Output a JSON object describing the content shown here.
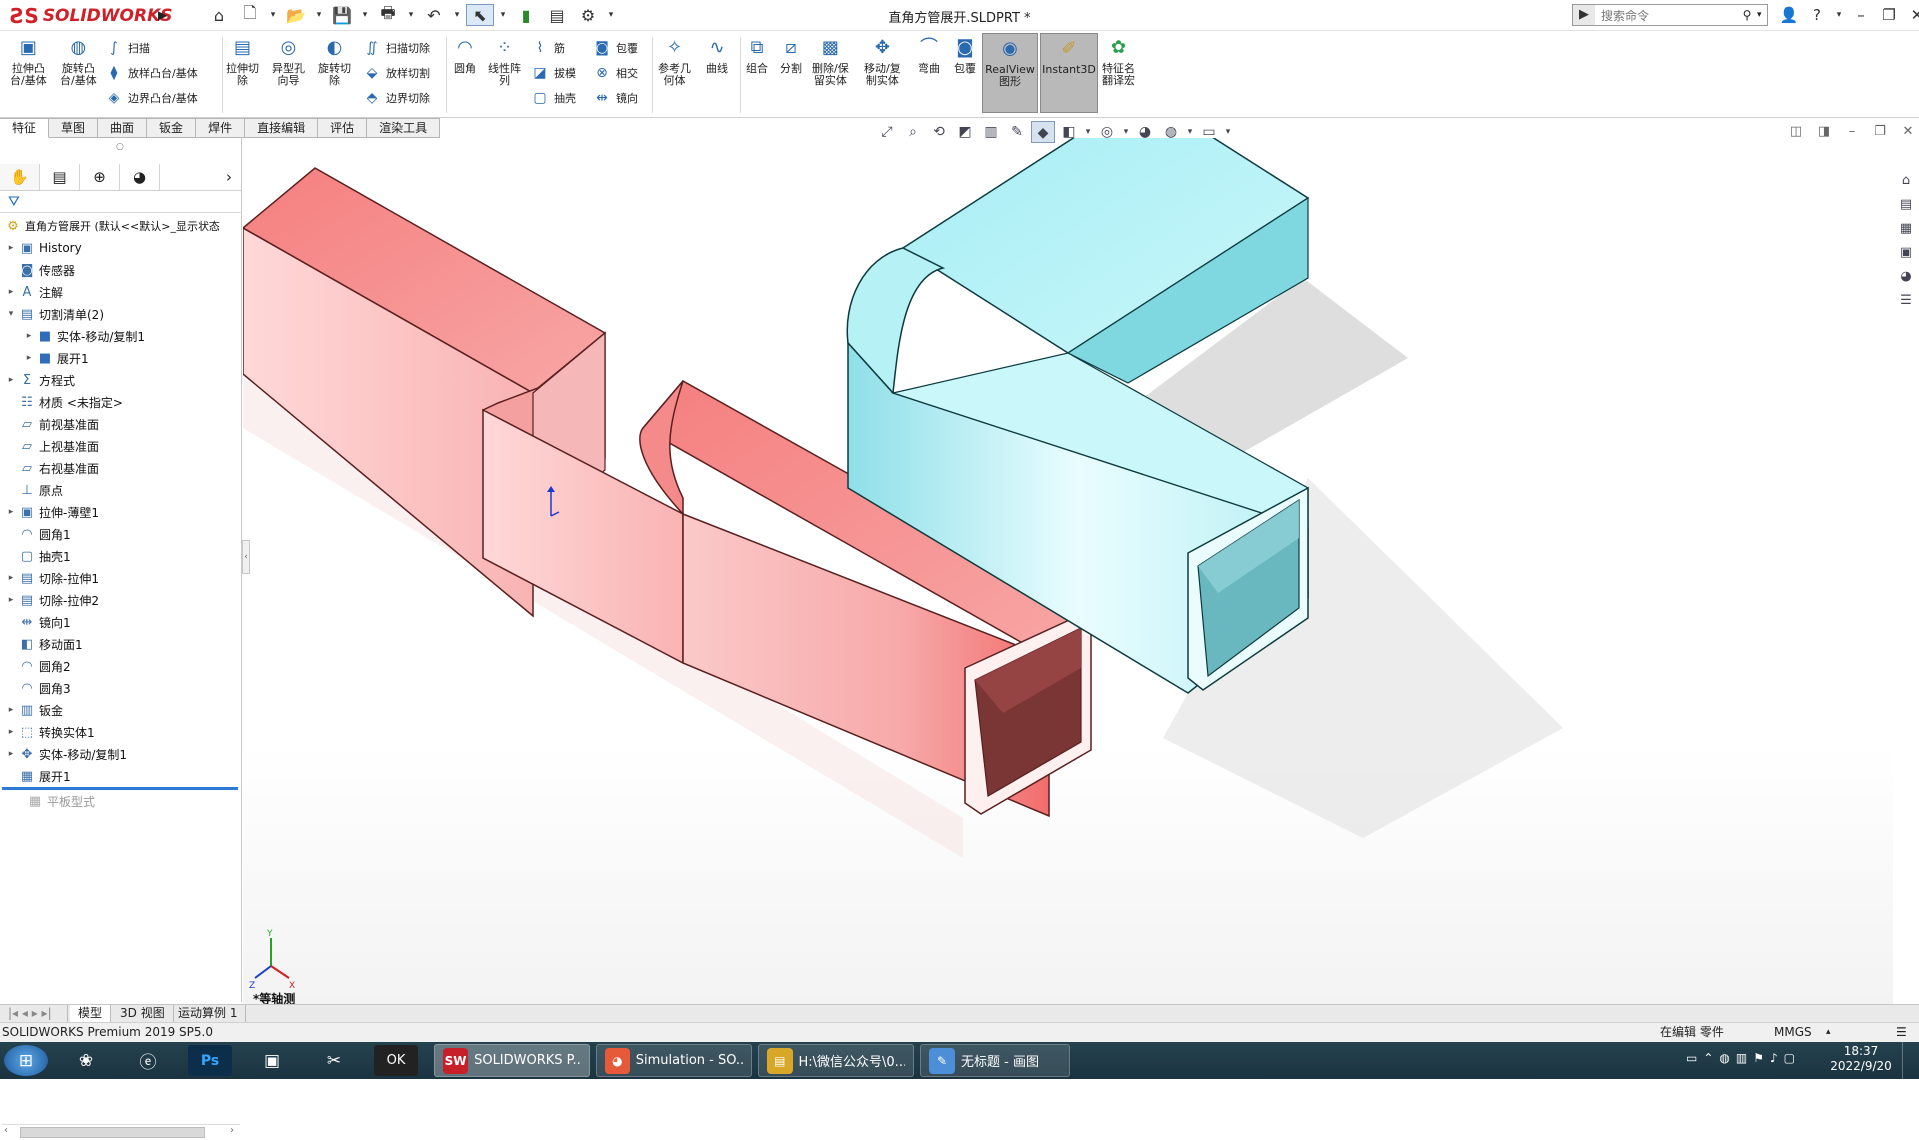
{
  "app": {
    "logo_text": "SOLIDWORKS",
    "document_title": "直角方管展开.SLDPRT *",
    "search_placeholder": "搜索命令"
  },
  "ribbon": {
    "extrude_boss": "拉伸凸\n台/基体",
    "revolve_boss": "旋转凸\n台/基体",
    "sweep": "扫描",
    "loft": "放样凸台/基体",
    "boundary": "边界凸台/基体",
    "extrude_cut": "拉伸切\n除",
    "hole_wizard": "异型孔\n向导",
    "revolve_cut": "旋转切\n除",
    "swept_cut": "扫描切除",
    "lofted_cut": "放样切割",
    "boundary_cut": "边界切除",
    "fillet": "圆角",
    "linear_pattern": "线性阵\n列",
    "rib": "筋",
    "draft": "拔模",
    "shell": "抽壳",
    "wrap": "包覆",
    "intersect": "相交",
    "mirror": "镜向",
    "ref_geometry": "参考几\n何体",
    "curves": "曲线",
    "combine": "组合",
    "split": "分割",
    "delete_body": "删除/保\n留实体",
    "move_copy": "移动/复\n制实体",
    "flex": "弯曲",
    "wrap2": "包覆",
    "realview": "RealView\n图形",
    "instant3d": "Instant3D",
    "feature_translate": "特征名\n翻译宏"
  },
  "tabs": [
    "特征",
    "草图",
    "曲面",
    "钣金",
    "焊件",
    "直接编辑",
    "评估",
    "渲染工具"
  ],
  "tree": {
    "root": "直角方管展开  (默认<<默认>_显示状态",
    "items": [
      {
        "label": "History",
        "icon": "history-icon",
        "expand": "▸",
        "indent": 0
      },
      {
        "label": "传感器",
        "icon": "sensor-icon",
        "expand": "",
        "indent": 0
      },
      {
        "label": "注解",
        "icon": "annotation-icon",
        "expand": "▸",
        "indent": 0
      },
      {
        "label": "切割清单(2)",
        "icon": "cut-list-icon",
        "expand": "▾",
        "indent": 0
      },
      {
        "label": "实体-移动/复制1",
        "icon": "solid-body-icon",
        "expand": "▸",
        "indent": 1
      },
      {
        "label": "展开1",
        "icon": "solid-body-icon",
        "expand": "▸",
        "indent": 1
      },
      {
        "label": "方程式",
        "icon": "equation-icon",
        "expand": "▸",
        "indent": 0
      },
      {
        "label": "材质 <未指定>",
        "icon": "material-icon",
        "expand": "",
        "indent": 0
      },
      {
        "label": "前视基准面",
        "icon": "plane-icon",
        "expand": "",
        "indent": 0
      },
      {
        "label": "上视基准面",
        "icon": "plane-icon",
        "expand": "",
        "indent": 0
      },
      {
        "label": "右视基准面",
        "icon": "plane-icon",
        "expand": "",
        "indent": 0
      },
      {
        "label": "原点",
        "icon": "origin-icon",
        "expand": "",
        "indent": 0
      },
      {
        "label": "拉伸-薄壁1",
        "icon": "extrude-icon",
        "expand": "▸",
        "indent": 0
      },
      {
        "label": "圆角1",
        "icon": "fillet-icon",
        "expand": "",
        "indent": 0
      },
      {
        "label": "抽壳1",
        "icon": "shell-icon",
        "expand": "",
        "indent": 0
      },
      {
        "label": "切除-拉伸1",
        "icon": "cut-extrude-icon",
        "expand": "▸",
        "indent": 0
      },
      {
        "label": "切除-拉伸2",
        "icon": "cut-extrude-icon",
        "expand": "▸",
        "indent": 0
      },
      {
        "label": "镜向1",
        "icon": "mirror-icon",
        "expand": "",
        "indent": 0
      },
      {
        "label": "移动面1",
        "icon": "move-face-icon",
        "expand": "",
        "indent": 0
      },
      {
        "label": "圆角2",
        "icon": "fillet-icon",
        "expand": "",
        "indent": 0
      },
      {
        "label": "圆角3",
        "icon": "fillet-icon",
        "expand": "",
        "indent": 0
      },
      {
        "label": "钣金",
        "icon": "sheet-metal-icon",
        "expand": "▸",
        "indent": 0
      },
      {
        "label": "转换实体1",
        "icon": "convert-icon",
        "expand": "▸",
        "indent": 0
      },
      {
        "label": "实体-移动/复制1",
        "icon": "move-copy-icon",
        "expand": "▸",
        "indent": 0
      },
      {
        "label": "展开1",
        "icon": "unfold-icon",
        "expand": "",
        "indent": 0
      }
    ],
    "suppressed": "平板型式"
  },
  "bottom_tabs": [
    "模型",
    "3D 视图",
    "运动算例 1"
  ],
  "viewport": {
    "view_label": "*等轴测"
  },
  "status": {
    "left": "SOLIDWORKS Premium 2019 SP5.0",
    "editing": "在编辑 零件",
    "units": "MMGS"
  },
  "taskbar": {
    "apps": [
      {
        "label": "SOLIDWORKS P...",
        "icon_text": "SW",
        "color": "#c8202a"
      },
      {
        "label": "Simulation - SO...",
        "icon_text": "◕",
        "color": "#e65a3a"
      },
      {
        "label": "H:\\微信公众号\\0...",
        "icon_text": "▤",
        "color": "#d9a728"
      },
      {
        "label": "无标题 - 画图",
        "icon_text": "✎",
        "color": "#4c8fd6"
      }
    ],
    "time": "18:37",
    "date": "2022/9/20"
  },
  "colors": {
    "red_body": "#f48a8a",
    "cyan_body": "#a8ecf2",
    "accent": "#2c7ad6"
  }
}
